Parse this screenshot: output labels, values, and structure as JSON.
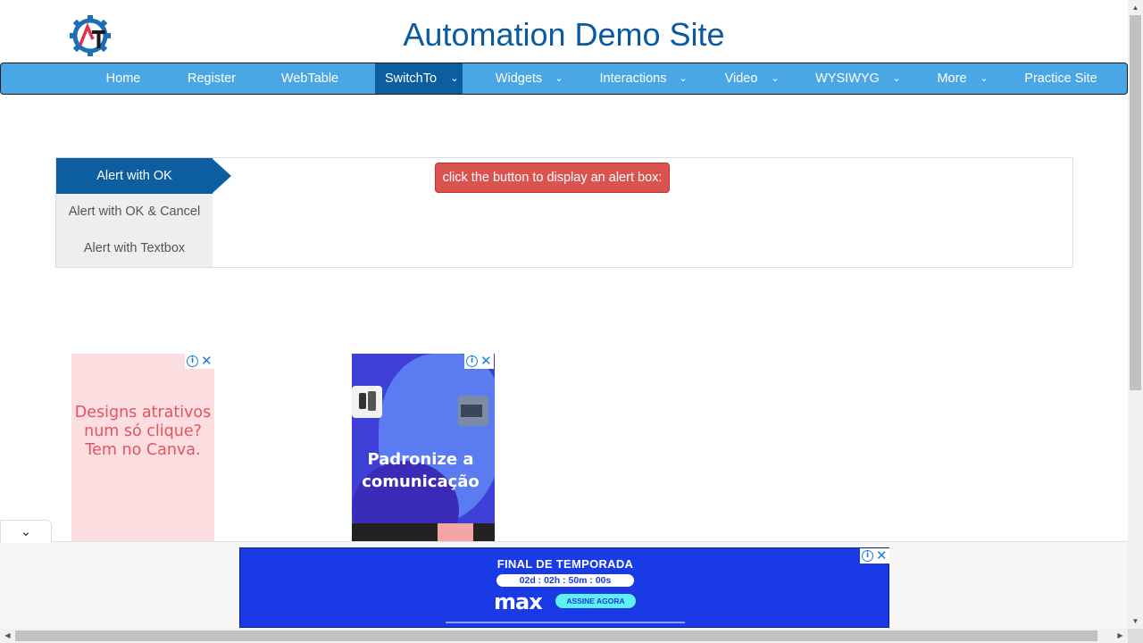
{
  "header": {
    "title": "Automation Demo Site",
    "logo_icon": "gear-logo-icon"
  },
  "navbar": {
    "items": [
      {
        "label": "Home"
      },
      {
        "label": "Register"
      },
      {
        "label": "WebTable"
      },
      {
        "label": "SwitchTo",
        "active": true
      },
      {
        "label": "Widgets"
      },
      {
        "label": "Interactions"
      },
      {
        "label": "Video"
      },
      {
        "label": "WYSIWYG"
      },
      {
        "label": "More"
      },
      {
        "label": "Practice Site"
      }
    ],
    "caret": "⌄",
    "colors": {
      "bar": "#4aa7e6",
      "active": "#0d5ea0"
    }
  },
  "alerts": {
    "tabs": [
      {
        "label": "Alert with OK",
        "active": true
      },
      {
        "label": "Alert with OK & Cancel"
      },
      {
        "label": "Alert with Textbox"
      }
    ],
    "button_label": "click the button to display an alert box:",
    "button_color": "#d9534f"
  },
  "ads": {
    "canva": {
      "text": "Designs atrativos num só clique? Tem no Canva."
    },
    "blue": {
      "text": "Padronize a comunicação"
    },
    "info_glyph": "i",
    "close_glyph": "✕",
    "max": {
      "title": "FINAL DE TEMPORADA",
      "timer": "02d : 02h : 50m : 00s",
      "logo": "max",
      "cta": "ASSINE AGORA"
    }
  },
  "ui": {
    "collapse_glyph": "⌄",
    "scroll_up": "▲",
    "scroll_down": "▼",
    "scroll_left": "◀",
    "scroll_right": "▶"
  }
}
